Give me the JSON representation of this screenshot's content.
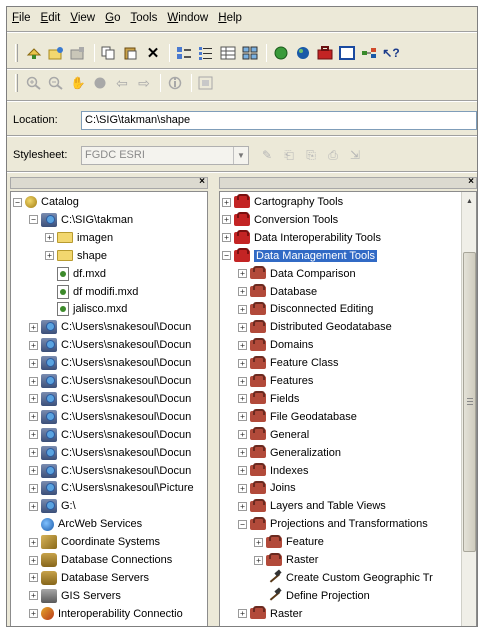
{
  "menubar": {
    "items": [
      {
        "ul": "F",
        "rest": "ile"
      },
      {
        "ul": "E",
        "rest": "dit"
      },
      {
        "ul": "V",
        "rest": "iew"
      },
      {
        "ul": "G",
        "rest": "o"
      },
      {
        "ul": "T",
        "rest": "ools"
      },
      {
        "ul": "W",
        "rest": "indow"
      },
      {
        "ul": "H",
        "rest": "elp"
      }
    ]
  },
  "location": {
    "label": "Location:",
    "value": "C:\\SIG\\takman\\shape"
  },
  "stylesheet": {
    "label": "Stylesheet:",
    "value": "FGDC ESRI"
  },
  "catalog_tree": [
    {
      "label": "Catalog",
      "icon": "catalog-icon",
      "exp": "minus",
      "indent": 0
    },
    {
      "label": "C:\\SIG\\takman",
      "icon": "folder-connection-icon",
      "exp": "minus",
      "indent": 1
    },
    {
      "label": "imagen",
      "icon": "folder-icon",
      "exp": "plus",
      "indent": 2
    },
    {
      "label": "shape",
      "icon": "folder-icon",
      "exp": "plus",
      "indent": 2
    },
    {
      "label": "df.mxd",
      "icon": "map-document-icon",
      "exp": "none",
      "indent": 2
    },
    {
      "label": "df modifi.mxd",
      "icon": "map-document-icon",
      "exp": "none",
      "indent": 2
    },
    {
      "label": "jalisco.mxd",
      "icon": "map-document-icon",
      "exp": "none",
      "indent": 2
    },
    {
      "label": "C:\\Users\\snakesoul\\Docun",
      "icon": "folder-connection-icon",
      "exp": "plus",
      "indent": 1
    },
    {
      "label": "C:\\Users\\snakesoul\\Docun",
      "icon": "folder-connection-icon",
      "exp": "plus",
      "indent": 1
    },
    {
      "label": "C:\\Users\\snakesoul\\Docun",
      "icon": "folder-connection-icon",
      "exp": "plus",
      "indent": 1
    },
    {
      "label": "C:\\Users\\snakesoul\\Docun",
      "icon": "folder-connection-icon",
      "exp": "plus",
      "indent": 1
    },
    {
      "label": "C:\\Users\\snakesoul\\Docun",
      "icon": "folder-connection-icon",
      "exp": "plus",
      "indent": 1
    },
    {
      "label": "C:\\Users\\snakesoul\\Docun",
      "icon": "folder-connection-icon",
      "exp": "plus",
      "indent": 1
    },
    {
      "label": "C:\\Users\\snakesoul\\Docun",
      "icon": "folder-connection-icon",
      "exp": "plus",
      "indent": 1
    },
    {
      "label": "C:\\Users\\snakesoul\\Docun",
      "icon": "folder-connection-icon",
      "exp": "plus",
      "indent": 1
    },
    {
      "label": "C:\\Users\\snakesoul\\Docun",
      "icon": "folder-connection-icon",
      "exp": "plus",
      "indent": 1
    },
    {
      "label": "C:\\Users\\snakesoul\\Picture",
      "icon": "folder-connection-icon",
      "exp": "plus",
      "indent": 1
    },
    {
      "label": "G:\\",
      "icon": "folder-connection-icon",
      "exp": "plus",
      "indent": 1
    },
    {
      "label": "ArcWeb Services",
      "icon": "globe-icon",
      "exp": "none",
      "indent": 1
    },
    {
      "label": "Coordinate Systems",
      "icon": "coordinate-systems-icon",
      "exp": "plus",
      "indent": 1
    },
    {
      "label": "Database Connections",
      "icon": "database-connections-icon",
      "exp": "plus",
      "indent": 1
    },
    {
      "label": "Database Servers",
      "icon": "database-servers-icon",
      "exp": "plus",
      "indent": 1
    },
    {
      "label": "GIS Servers",
      "icon": "gis-servers-icon",
      "exp": "plus",
      "indent": 1
    },
    {
      "label": "Interoperability Connectio",
      "icon": "interoperability-icon",
      "exp": "plus",
      "indent": 1
    }
  ],
  "toolbox_tree": [
    {
      "label": "Cartography Tools",
      "icon": "toolbox-icon",
      "exp": "plus",
      "indent": 0
    },
    {
      "label": "Conversion Tools",
      "icon": "toolbox-icon",
      "exp": "plus",
      "indent": 0
    },
    {
      "label": "Data Interoperability Tools",
      "icon": "toolbox-icon",
      "exp": "plus",
      "indent": 0
    },
    {
      "label": "Data Management Tools",
      "icon": "toolbox-icon",
      "exp": "minus",
      "indent": 0,
      "selected": true
    },
    {
      "label": "Data Comparison",
      "icon": "toolset-icon",
      "exp": "plus",
      "indent": 1
    },
    {
      "label": "Database",
      "icon": "toolset-icon",
      "exp": "plus",
      "indent": 1
    },
    {
      "label": "Disconnected Editing",
      "icon": "toolset-icon",
      "exp": "plus",
      "indent": 1
    },
    {
      "label": "Distributed Geodatabase",
      "icon": "toolset-icon",
      "exp": "plus",
      "indent": 1
    },
    {
      "label": "Domains",
      "icon": "toolset-icon",
      "exp": "plus",
      "indent": 1
    },
    {
      "label": "Feature Class",
      "icon": "toolset-icon",
      "exp": "plus",
      "indent": 1
    },
    {
      "label": "Features",
      "icon": "toolset-icon",
      "exp": "plus",
      "indent": 1
    },
    {
      "label": "Fields",
      "icon": "toolset-icon",
      "exp": "plus",
      "indent": 1
    },
    {
      "label": "File Geodatabase",
      "icon": "toolset-icon",
      "exp": "plus",
      "indent": 1
    },
    {
      "label": "General",
      "icon": "toolset-icon",
      "exp": "plus",
      "indent": 1
    },
    {
      "label": "Generalization",
      "icon": "toolset-icon",
      "exp": "plus",
      "indent": 1
    },
    {
      "label": "Indexes",
      "icon": "toolset-icon",
      "exp": "plus",
      "indent": 1
    },
    {
      "label": "Joins",
      "icon": "toolset-icon",
      "exp": "plus",
      "indent": 1
    },
    {
      "label": "Layers and Table Views",
      "icon": "toolset-icon",
      "exp": "plus",
      "indent": 1
    },
    {
      "label": "Projections and Transformations",
      "icon": "toolset-icon",
      "exp": "minus",
      "indent": 1
    },
    {
      "label": "Feature",
      "icon": "toolset-icon",
      "exp": "plus",
      "indent": 2
    },
    {
      "label": "Raster",
      "icon": "toolset-icon",
      "exp": "plus",
      "indent": 2
    },
    {
      "label": "Create Custom Geographic Tr",
      "icon": "tool-hammer-icon",
      "exp": "none",
      "indent": 2
    },
    {
      "label": "Define Projection",
      "icon": "tool-hammer-icon",
      "exp": "none",
      "indent": 2
    },
    {
      "label": "Raster",
      "icon": "toolset-icon",
      "exp": "plus",
      "indent": 1
    }
  ],
  "colors": {
    "selection": "#316ac5",
    "toolbox_red": "#c32424",
    "chrome": "#ece9d8"
  }
}
